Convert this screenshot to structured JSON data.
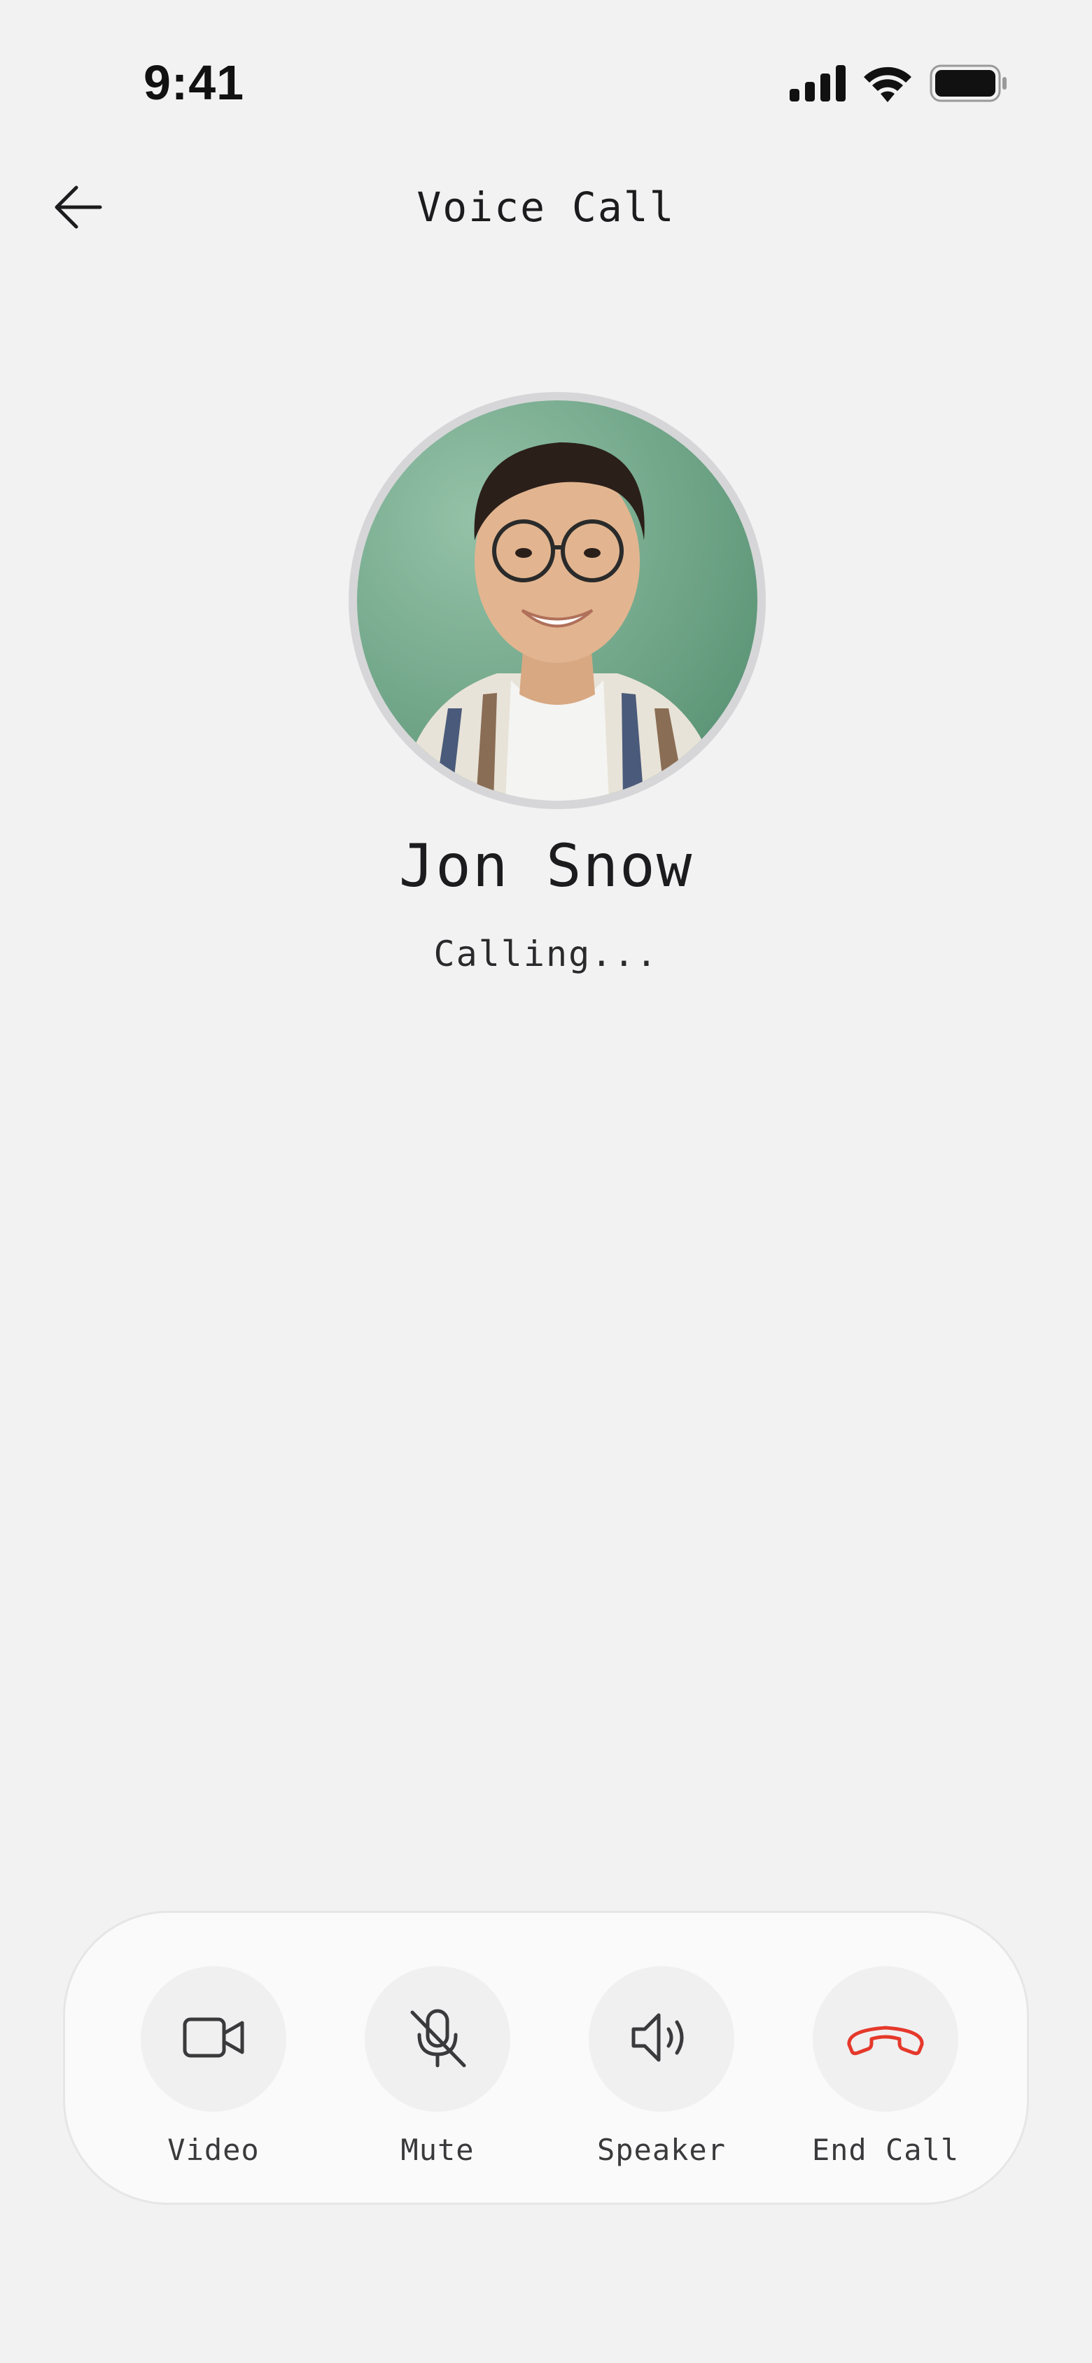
{
  "status_bar": {
    "time": "9:41"
  },
  "header": {
    "title": "Voice Call"
  },
  "caller": {
    "name": "Jon Snow",
    "status": "Calling..."
  },
  "controls": [
    {
      "label": "Video",
      "icon": "video-camera-icon"
    },
    {
      "label": "Mute",
      "icon": "mic-off-icon"
    },
    {
      "label": "Speaker",
      "icon": "speaker-icon"
    },
    {
      "label": "End Call",
      "icon": "phone-hangup-icon"
    }
  ],
  "colors": {
    "background": "#f2f2f2",
    "end_call": "#e5392b",
    "icon": "#3a3a3c"
  }
}
